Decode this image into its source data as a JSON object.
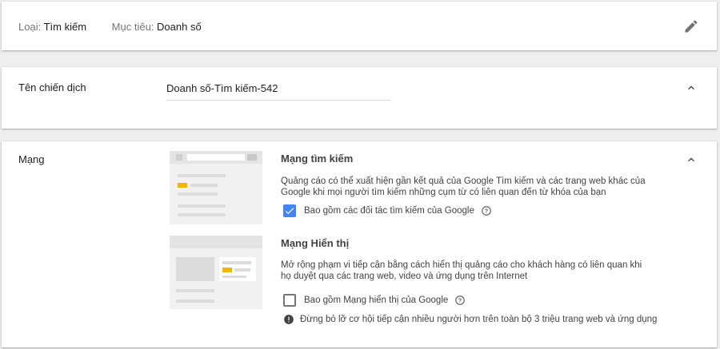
{
  "summary": {
    "type_label": "Loại:",
    "type_value": "Tìm kiếm",
    "goal_label": "Mục tiêu:",
    "goal_value": "Doanh số"
  },
  "campaign_name": {
    "label": "Tên chiến dịch",
    "value": "Doanh số-Tìm kiếm-542"
  },
  "networks": {
    "label": "Mạng",
    "search": {
      "title": "Mạng tìm kiếm",
      "description": "Quảng cáo có thể xuất hiện gần kết quả của Google Tìm kiếm và các trang web khác của Google khi mọi người tìm kiếm những cụm từ có liên quan đến từ khóa của bạn",
      "checkbox_label": "Bao gồm các đối tác tìm kiếm của Google",
      "checked": true
    },
    "display": {
      "title": "Mạng Hiển thị",
      "description": "Mở rộng phạm vi tiếp cận bằng cách hiển thị quảng cáo cho khách hàng có liên quan khi họ duyệt qua các trang web, video và ứng dụng trên Internet",
      "checkbox_label": "Bao gồm Mạng hiển thị của Google",
      "checked": false,
      "warning": "Đừng bỏ lỡ cơ hội tiếp cận nhiều người hơn trên toàn bộ 3 triệu trang web và ứng dụng"
    }
  },
  "colors": {
    "accent": "#4285f4",
    "highlight": "#f4b400",
    "background": "#eeeeee"
  },
  "icons": {
    "edit": "pencil-icon",
    "collapse": "chevron-up-icon",
    "help": "help-circle-icon",
    "warning": "error-circle-icon",
    "check": "check-icon"
  }
}
